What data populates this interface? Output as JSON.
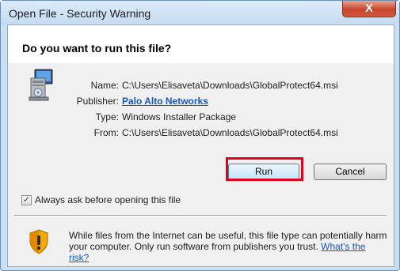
{
  "window": {
    "title": "Open File - Security Warning",
    "close_label": "X"
  },
  "heading": "Do you want to run this file?",
  "details": [
    {
      "label": "Name:",
      "value": "C:\\Users\\Elisaveta\\Downloads\\GlobalProtect64.msi"
    },
    {
      "label": "Publisher:",
      "value": "Palo Alto Networks"
    },
    {
      "label": "Type:",
      "value": "Windows Installer Package"
    },
    {
      "label": "From:",
      "value": "C:\\Users\\Elisaveta\\Downloads\\GlobalProtect64.msi"
    }
  ],
  "buttons": {
    "run": "Run",
    "cancel": "Cancel"
  },
  "checkbox": {
    "label": "Always ask before opening this file",
    "checked_glyph": "✓"
  },
  "warning": {
    "text": "While files from the Internet can be useful, this file type can potentially harm your computer. Only run software from publishers you trust.",
    "link": "What's the risk?"
  },
  "icons": {
    "file": "installer-file-icon",
    "shield": "security-shield-icon"
  },
  "colors": {
    "highlight": "#e2001a",
    "link": "#1a55c6"
  }
}
